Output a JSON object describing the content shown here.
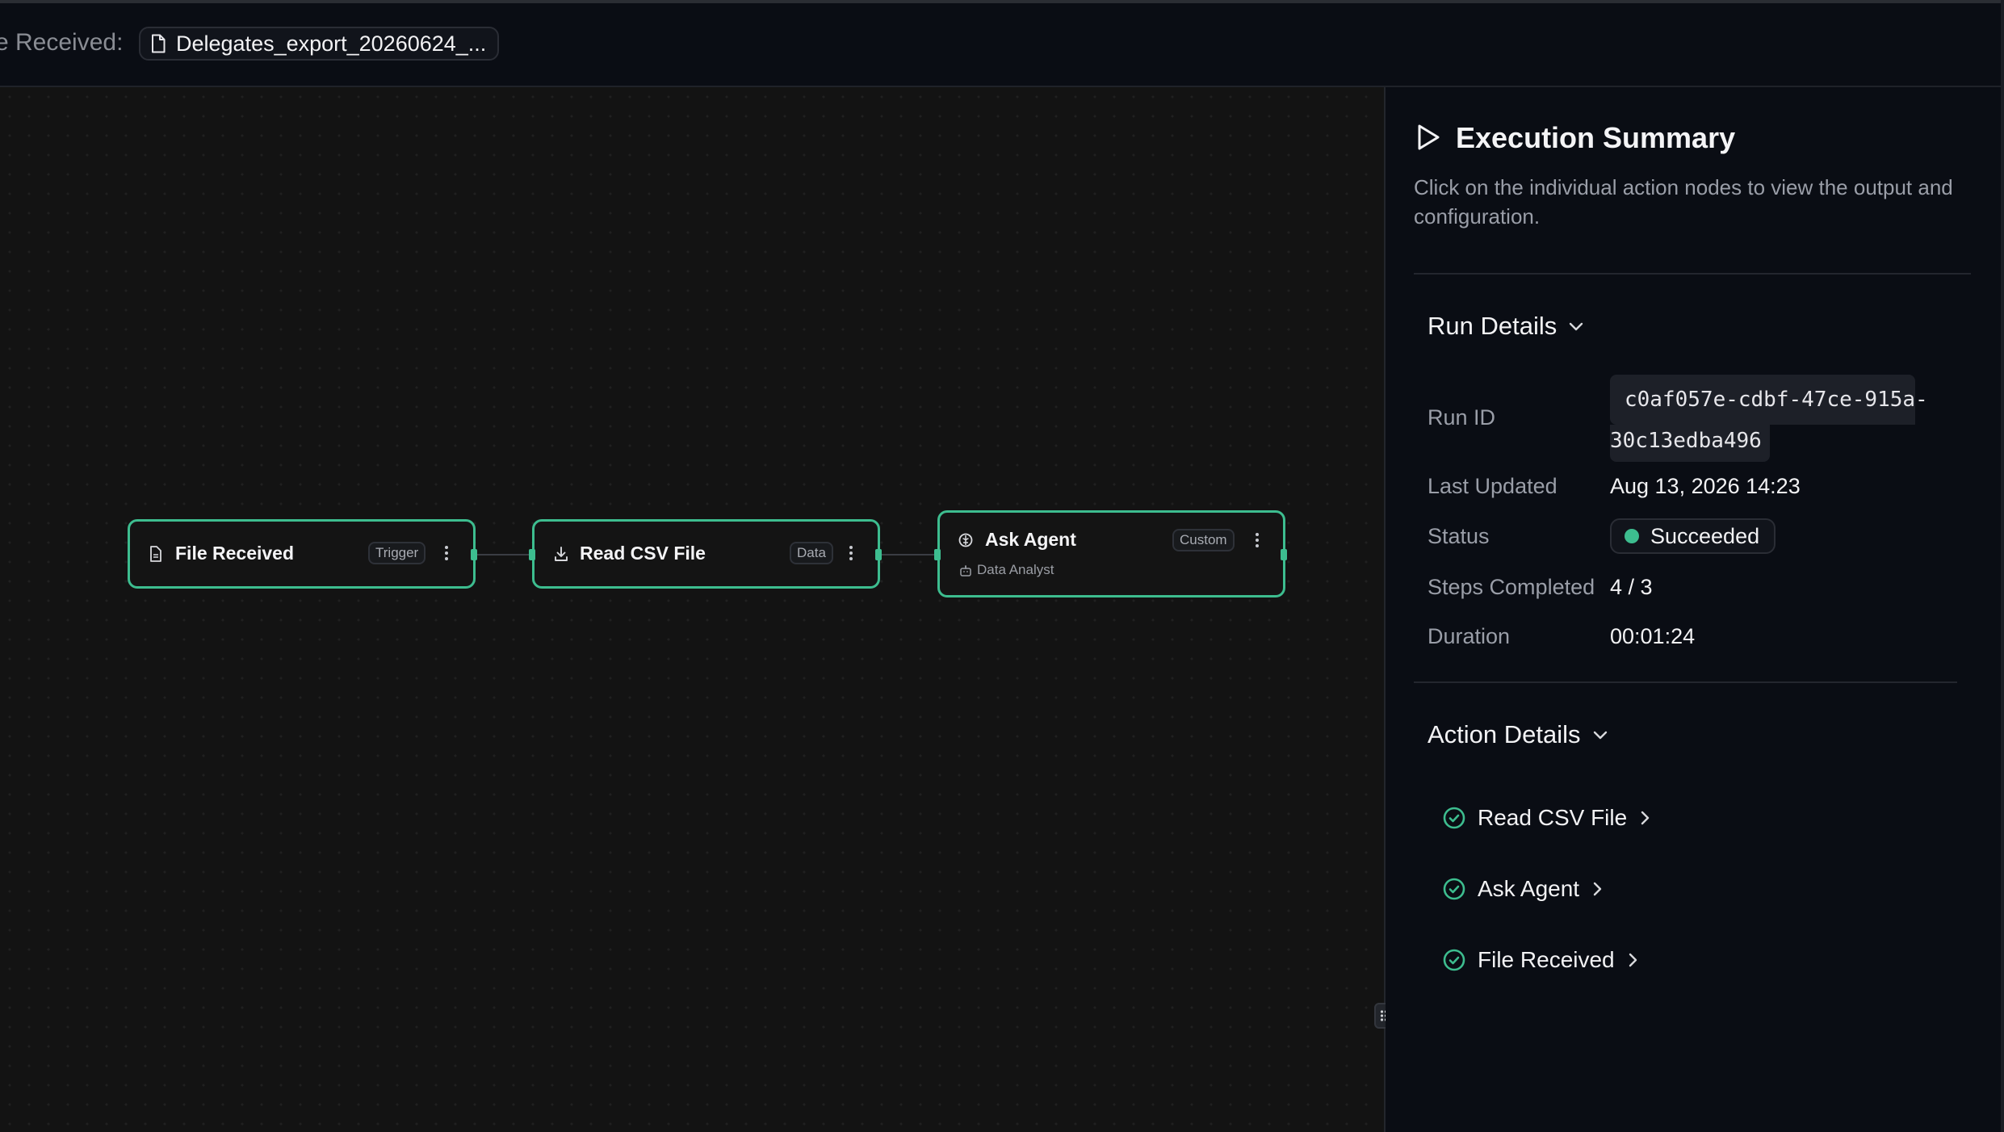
{
  "header": {
    "trigger_label": "e Received:",
    "file_name": "Delegates_export_20260624_..."
  },
  "workflow": {
    "nodes": [
      {
        "title": "File Received",
        "badge": "Trigger",
        "icon": "file-icon"
      },
      {
        "title": "Read CSV File",
        "badge": "Data",
        "icon": "download-icon"
      },
      {
        "title": "Ask Agent",
        "badge": "Custom",
        "icon": "brain-icon",
        "subtitle": "Data Analyst",
        "subtitle_icon": "robot-icon"
      }
    ]
  },
  "panel": {
    "title": "Execution Summary",
    "description": "Click on the individual action nodes to view the output and configuration.",
    "run_details": {
      "heading": "Run Details",
      "run_id_label": "Run ID",
      "run_id_line1": "c0af057e-cdbf-47ce-915a-",
      "run_id_line2": "30c13edba496",
      "last_updated_label": "Last Updated",
      "last_updated": "Aug 13, 2026 14:23",
      "status_label": "Status",
      "status": "Succeeded",
      "steps_label": "Steps Completed",
      "steps": "4 / 3",
      "duration_label": "Duration",
      "duration": "00:01:24"
    },
    "action_details": {
      "heading": "Action Details",
      "items": [
        "Read CSV File",
        "Ask Agent",
        "File Received"
      ]
    }
  },
  "colors": {
    "accent": "#3dbd8f",
    "canvas_bg": "#131313",
    "panel_bg": "#0a0d14"
  }
}
